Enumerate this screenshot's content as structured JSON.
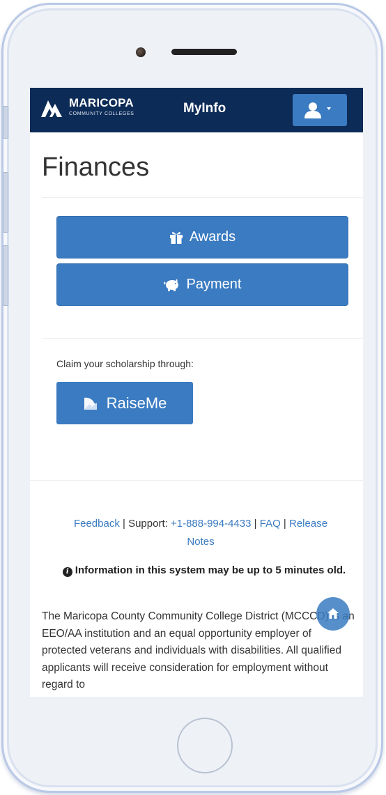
{
  "header": {
    "logo_primary": "MARICOPA",
    "logo_secondary": "COMMUNITY COLLEGES",
    "brand": "MyInfo",
    "user_menu_icon": "user-icon"
  },
  "page": {
    "title": "Finances"
  },
  "actions": {
    "awards_label": "Awards",
    "awards_icon": "gift-icon",
    "payment_label": "Payment",
    "payment_icon": "piggy-bank-icon"
  },
  "scholarship": {
    "prompt": "Claim your scholarship through:",
    "button_label": "RaiseMe"
  },
  "footer": {
    "feedback": "Feedback",
    "separator": "|",
    "support_label": "Support:",
    "phone": "+1-888-994-4433",
    "faq": "FAQ",
    "release_notes": "Release Notes",
    "info_notice": "Information in this system may be up to 5 minutes old.",
    "disclaimer": "The Maricopa County Community College District (MCCCD) is an EEO/AA institution and an equal opportunity employer of protected veterans and individuals with disabilities. All qualified applicants will receive consideration for employment without regard to"
  },
  "fab": {
    "icon": "home-icon"
  },
  "colors": {
    "navbar": "#0c2b57",
    "primary": "#3a7bc1"
  }
}
